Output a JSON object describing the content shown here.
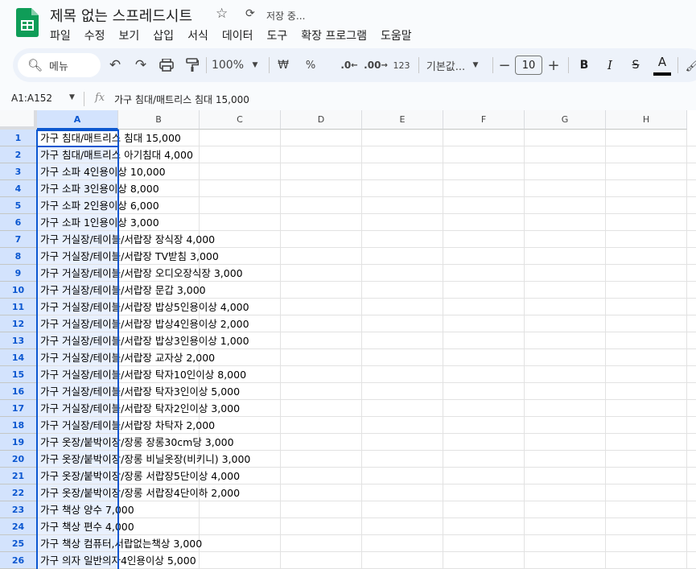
{
  "title": "제목 없는 스프레드시트",
  "save_status": "저장 중...",
  "menu": [
    "파일",
    "수정",
    "보기",
    "삽입",
    "서식",
    "데이터",
    "도구",
    "확장 프로그램",
    "도움말"
  ],
  "toolbar": {
    "search_label": "메뉴",
    "zoom": "100%",
    "currency": "₩",
    "percent": "%",
    "decrease_decimal": ".0",
    "increase_decimal": ".00",
    "number_format": "123",
    "font_name": "기본값...",
    "font_size": "10",
    "bold": "B",
    "italic": "I",
    "strikethrough": "S",
    "text_color": "A"
  },
  "formula_bar": {
    "name_box": "A1:A152",
    "fx": "fx",
    "formula": "가구 침대/매트리스 침대 15,000"
  },
  "columns": [
    "A",
    "B",
    "C",
    "D",
    "E",
    "F",
    "G",
    "H"
  ],
  "rows": [
    {
      "n": "1",
      "a": "가구 침대/매트리스 침대 15,000"
    },
    {
      "n": "2",
      "a": "가구 침대/매트리스 아기침대 4,000"
    },
    {
      "n": "3",
      "a": "가구 소파 4인용이상 10,000"
    },
    {
      "n": "4",
      "a": "가구 소파 3인용이상 8,000"
    },
    {
      "n": "5",
      "a": "가구 소파 2인용이상 6,000"
    },
    {
      "n": "6",
      "a": "가구 소파 1인용이상 3,000"
    },
    {
      "n": "7",
      "a": "가구 거실장/테이블/서랍장 장식장 4,000"
    },
    {
      "n": "8",
      "a": "가구 거실장/테이블/서랍장 TV받침 3,000"
    },
    {
      "n": "9",
      "a": "가구 거실장/테이블/서랍장 오디오장식장 3,000"
    },
    {
      "n": "10",
      "a": "가구 거실장/테이블/서랍장 문갑 3,000"
    },
    {
      "n": "11",
      "a": "가구 거실장/테이블/서랍장 밥상5인용이상 4,000"
    },
    {
      "n": "12",
      "a": "가구 거실장/테이블/서랍장 밥상4인용이상 2,000"
    },
    {
      "n": "13",
      "a": "가구 거실장/테이블/서랍장 밥상3인용이상 1,000"
    },
    {
      "n": "14",
      "a": "가구 거실장/테이블/서랍장 교자상 2,000"
    },
    {
      "n": "15",
      "a": "가구 거실장/테이블/서랍장 탁자10인이상 8,000"
    },
    {
      "n": "16",
      "a": "가구 거실장/테이블/서랍장 탁자3인이상 5,000"
    },
    {
      "n": "17",
      "a": "가구 거실장/테이블/서랍장 탁자2인이상 3,000"
    },
    {
      "n": "18",
      "a": "가구 거실장/테이블/서랍장 차탁자 2,000"
    },
    {
      "n": "19",
      "a": "가구 옷장/붙박이장/장롱 장롱30cm당 3,000"
    },
    {
      "n": "20",
      "a": "가구 옷장/붙박이장/장롱 비닐옷장(비키니) 3,000"
    },
    {
      "n": "21",
      "a": "가구 옷장/붙박이장/장롱 서랍장5단이상 4,000"
    },
    {
      "n": "22",
      "a": "가구 옷장/붙박이장/장롱 서랍장4단이하 2,000"
    },
    {
      "n": "23",
      "a": "가구 책상 양수 7,000"
    },
    {
      "n": "24",
      "a": "가구 책상 편수 4,000"
    },
    {
      "n": "25",
      "a": "가구 책상 컴퓨터,서랍없는책상 3,000"
    },
    {
      "n": "26",
      "a": "가구 의자 일반의자4인용이상 5,000"
    }
  ],
  "colors": {
    "accent": "#0b57d0",
    "selected_header": "#d3e3fd",
    "selected_column": "#e8f0fe",
    "toolbar_bg": "#edf2fa",
    "sheets_green": "#0f9d58"
  }
}
